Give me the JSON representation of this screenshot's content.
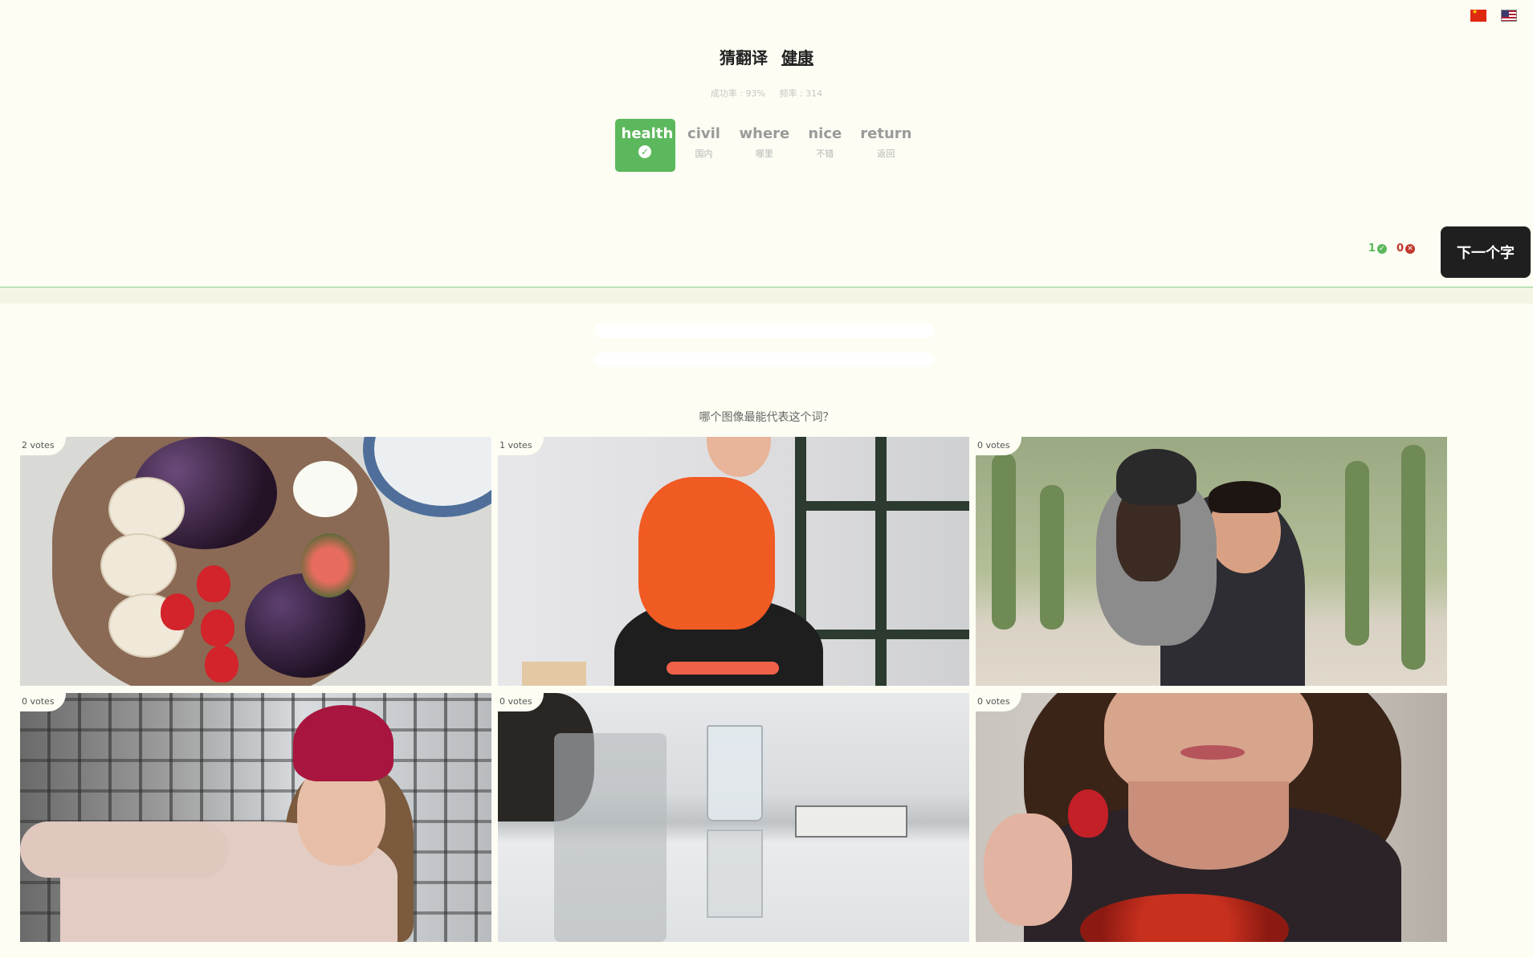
{
  "header": {
    "prefix": "猜翻译",
    "word": "健康",
    "stats": {
      "success_rate": "成功率 : 93%",
      "frequency": "频率 : 314"
    },
    "flags": [
      "cn-flag-icon",
      "us-flag-icon"
    ]
  },
  "options": [
    {
      "en": "health",
      "zh": "",
      "state": "correct",
      "icon": "check-circle-icon"
    },
    {
      "en": "civil",
      "zh": "国内",
      "state": "normal"
    },
    {
      "en": "where",
      "zh": "哪里",
      "state": "normal"
    },
    {
      "en": "nice",
      "zh": "不错",
      "state": "normal"
    },
    {
      "en": "return",
      "zh": "返回",
      "state": "normal"
    }
  ],
  "score": {
    "correct": "1",
    "wrong": "0"
  },
  "next_button": {
    "label": "下一个字"
  },
  "question": "哪个图像最能代表这个词？",
  "images": [
    {
      "votes": "2 votes",
      "subject": "food platter with crackers, grapes, strawberries and figs"
    },
    {
      "votes": "1 votes",
      "subject": "woman in orange shirt doing squat exercise"
    },
    {
      "votes": "0 votes",
      "subject": "man giving piggyback ride to woman near cacti"
    },
    {
      "votes": "0 votes",
      "subject": "smiling woman in red beanie near fence"
    },
    {
      "votes": "0 votes",
      "subject": "glass of water on table with books"
    },
    {
      "votes": "0 votes",
      "subject": "woman holding strawberry"
    }
  ],
  "colors": {
    "accent_green": "#5cb85c",
    "wrong_red": "#c0392b",
    "button_dark": "#1f1f1f",
    "page_bg": "#fdfdf4"
  }
}
